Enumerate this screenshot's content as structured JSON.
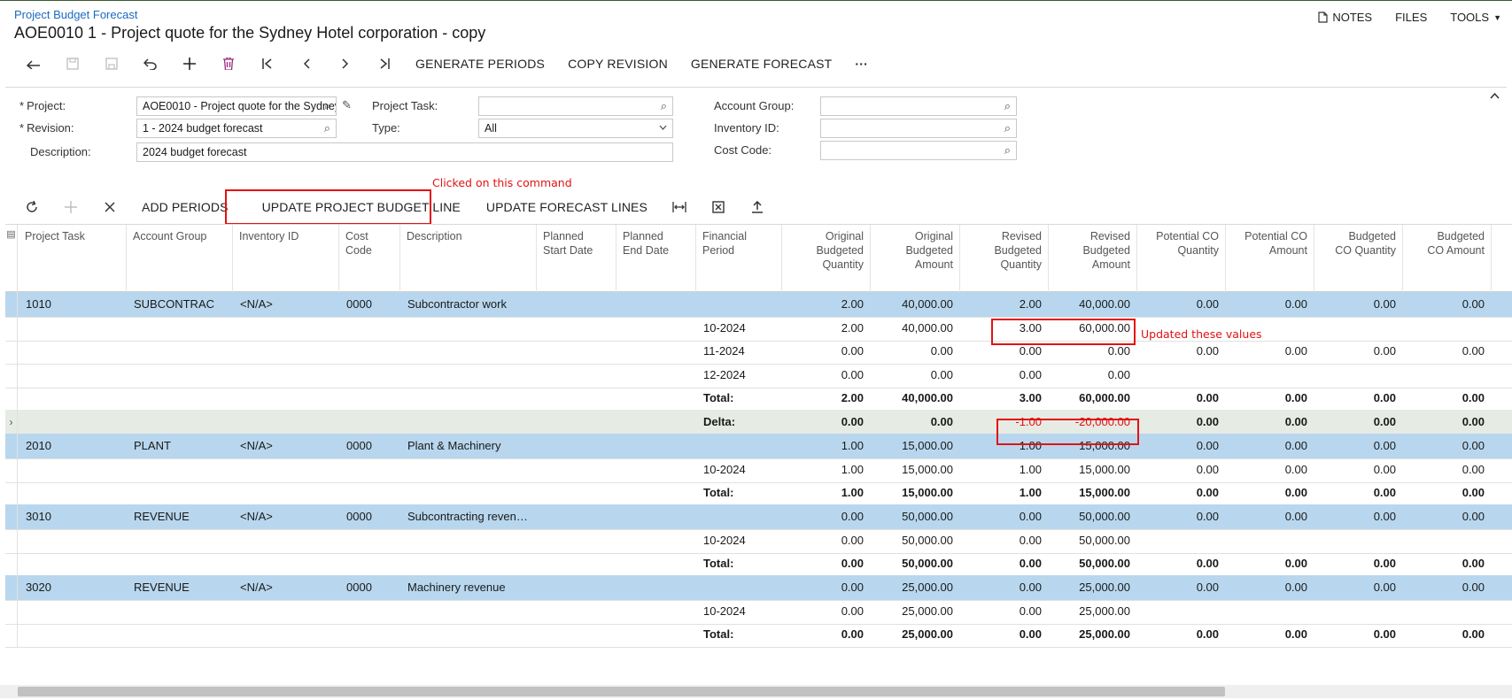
{
  "header": {
    "breadcrumb": "Project Budget Forecast",
    "title": "AOE0010 1 - Project quote for the Sydney Hotel corporation - copy",
    "notes": "NOTES",
    "files": "FILES",
    "tools": "TOOLS"
  },
  "toolbar": {
    "generate_periods": "GENERATE PERIODS",
    "copy_revision": "COPY REVISION",
    "generate_forecast": "GENERATE FORECAST",
    "more": "···"
  },
  "form": {
    "project_label": "Project:",
    "project_value": "AOE0010 - Project quote for the Sydney",
    "revision_label": "Revision:",
    "revision_value": "1 - 2024 budget forecast",
    "description_label": "Description:",
    "description_value": "2024 budget forecast",
    "project_task_label": "Project Task:",
    "project_task_value": "",
    "type_label": "Type:",
    "type_value": "All",
    "account_group_label": "Account Group:",
    "inventory_id_label": "Inventory ID:",
    "cost_code_label": "Cost Code:"
  },
  "grid_toolbar": {
    "add_periods": "ADD PERIODS",
    "update_project_budget_line": "UPDATE PROJECT BUDGET LINE",
    "update_forecast_lines": "UPDATE FORECAST LINES"
  },
  "annotations": {
    "clicked": "Clicked on this command",
    "updated": "Updated these values"
  },
  "columns": [
    "Project Task",
    "Account Group",
    "Inventory ID",
    "Cost\nCode",
    "Description",
    "Planned\nStart Date",
    "Planned\nEnd Date",
    "Financial\nPeriod",
    "Original\nBudgeted\nQuantity",
    "Original\nBudgeted\nAmount",
    "Revised\nBudgeted\nQuantity",
    "Revised\nBudgeted\nAmount",
    "Potential CO\nQuantity",
    "Potential CO\nAmount",
    "Budgeted\nCO Quantity",
    "Budgeted\nCO Amount"
  ],
  "rows": [
    {
      "type": "task",
      "task": "1010",
      "group": "SUBCONTRAC",
      "inv": "<N/A>",
      "cost": "0000",
      "desc": "Subcontractor work",
      "period": "",
      "oq": "2.00",
      "oa": "40,000.00",
      "rq": "2.00",
      "ra": "40,000.00",
      "pq": "0.00",
      "pa": "0.00",
      "bq": "0.00",
      "ba": "0.00"
    },
    {
      "type": "line",
      "period": "10-2024",
      "oq": "2.00",
      "oa": "40,000.00",
      "rq": "3.00",
      "ra": "60,000.00",
      "pq": "",
      "pa": "",
      "bq": "",
      "ba": ""
    },
    {
      "type": "line",
      "period": "11-2024",
      "oq": "0.00",
      "oa": "0.00",
      "rq": "0.00",
      "ra": "0.00",
      "pq": "0.00",
      "pa": "0.00",
      "bq": "0.00",
      "ba": "0.00"
    },
    {
      "type": "line",
      "period": "12-2024",
      "oq": "0.00",
      "oa": "0.00",
      "rq": "0.00",
      "ra": "0.00",
      "pq": "",
      "pa": "",
      "bq": "",
      "ba": ""
    },
    {
      "type": "total",
      "period": "Total:",
      "oq": "2.00",
      "oa": "40,000.00",
      "rq": "3.00",
      "ra": "60,000.00",
      "pq": "0.00",
      "pa": "0.00",
      "bq": "0.00",
      "ba": "0.00"
    },
    {
      "type": "delta",
      "period": "Delta:",
      "oq": "0.00",
      "oa": "0.00",
      "rq": "-1.00",
      "ra": "-20,000.00",
      "pq": "0.00",
      "pa": "0.00",
      "bq": "0.00",
      "ba": "0.00"
    },
    {
      "type": "task",
      "task": "2010",
      "group": "PLANT",
      "inv": "<N/A>",
      "cost": "0000",
      "desc": "Plant & Machinery",
      "period": "",
      "oq": "1.00",
      "oa": "15,000.00",
      "rq": "1.00",
      "ra": "15,000.00",
      "pq": "0.00",
      "pa": "0.00",
      "bq": "0.00",
      "ba": "0.00"
    },
    {
      "type": "line",
      "period": "10-2024",
      "oq": "1.00",
      "oa": "15,000.00",
      "rq": "1.00",
      "ra": "15,000.00",
      "pq": "0.00",
      "pa": "0.00",
      "bq": "0.00",
      "ba": "0.00"
    },
    {
      "type": "total",
      "period": "Total:",
      "oq": "1.00",
      "oa": "15,000.00",
      "rq": "1.00",
      "ra": "15,000.00",
      "pq": "0.00",
      "pa": "0.00",
      "bq": "0.00",
      "ba": "0.00"
    },
    {
      "type": "task",
      "task": "3010",
      "group": "REVENUE",
      "inv": "<N/A>",
      "cost": "0000",
      "desc": "Subcontracting reven…",
      "period": "",
      "oq": "0.00",
      "oa": "50,000.00",
      "rq": "0.00",
      "ra": "50,000.00",
      "pq": "0.00",
      "pa": "0.00",
      "bq": "0.00",
      "ba": "0.00"
    },
    {
      "type": "line",
      "period": "10-2024",
      "oq": "0.00",
      "oa": "50,000.00",
      "rq": "0.00",
      "ra": "50,000.00",
      "pq": "",
      "pa": "",
      "bq": "",
      "ba": ""
    },
    {
      "type": "total",
      "period": "Total:",
      "oq": "0.00",
      "oa": "50,000.00",
      "rq": "0.00",
      "ra": "50,000.00",
      "pq": "0.00",
      "pa": "0.00",
      "bq": "0.00",
      "ba": "0.00"
    },
    {
      "type": "task",
      "task": "3020",
      "group": "REVENUE",
      "inv": "<N/A>",
      "cost": "0000",
      "desc": "Machinery revenue",
      "period": "",
      "oq": "0.00",
      "oa": "25,000.00",
      "rq": "0.00",
      "ra": "25,000.00",
      "pq": "0.00",
      "pa": "0.00",
      "bq": "0.00",
      "ba": "0.00"
    },
    {
      "type": "line",
      "period": "10-2024",
      "oq": "0.00",
      "oa": "25,000.00",
      "rq": "0.00",
      "ra": "25,000.00",
      "pq": "",
      "pa": "",
      "bq": "",
      "ba": ""
    },
    {
      "type": "total",
      "period": "Total:",
      "oq": "0.00",
      "oa": "25,000.00",
      "rq": "0.00",
      "ra": "25,000.00",
      "pq": "0.00",
      "pa": "0.00",
      "bq": "0.00",
      "ba": "0.00"
    }
  ],
  "colors": {
    "task_row": "#b8d7ee",
    "delta_row": "#e6ebe4",
    "annotation": "#e21212",
    "link": "#1b6bbf"
  }
}
